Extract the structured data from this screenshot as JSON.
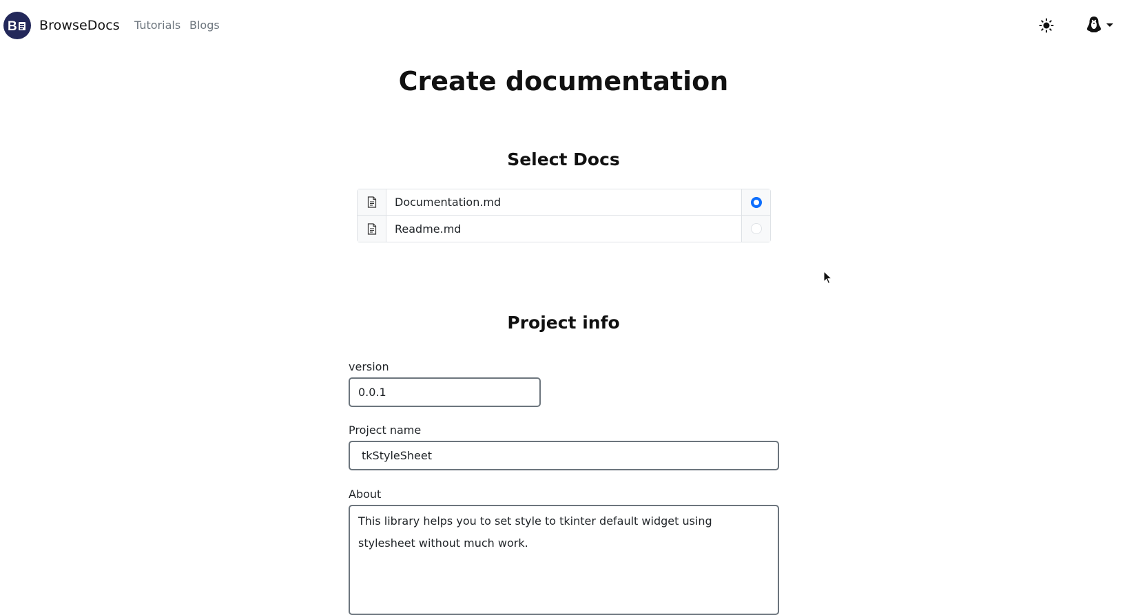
{
  "navbar": {
    "brand": "BrowseDocs",
    "links": [
      "Tutorials",
      "Blogs"
    ],
    "theme_icon": "sun-icon",
    "user_icon": "linux-user-icon"
  },
  "page": {
    "title": "Create documentation"
  },
  "select_docs": {
    "heading": "Select Docs",
    "items": [
      {
        "name": "Documentation.md",
        "icon": "file-text-icon",
        "selected": true
      },
      {
        "name": "Readme.md",
        "icon": "file-text-icon",
        "selected": false
      }
    ]
  },
  "project_info": {
    "heading": "Project info",
    "version_label": "version",
    "version_value": "0.0.1",
    "name_label": "Project name",
    "name_value": "tkStyleSheet",
    "about_label": "About",
    "about_value": "This library helps you to set style to tkinter default widget using stylesheet without much work."
  },
  "colors": {
    "accent": "#0d6efd",
    "brand_logo": "#23285a",
    "muted_text": "#6c757d"
  }
}
